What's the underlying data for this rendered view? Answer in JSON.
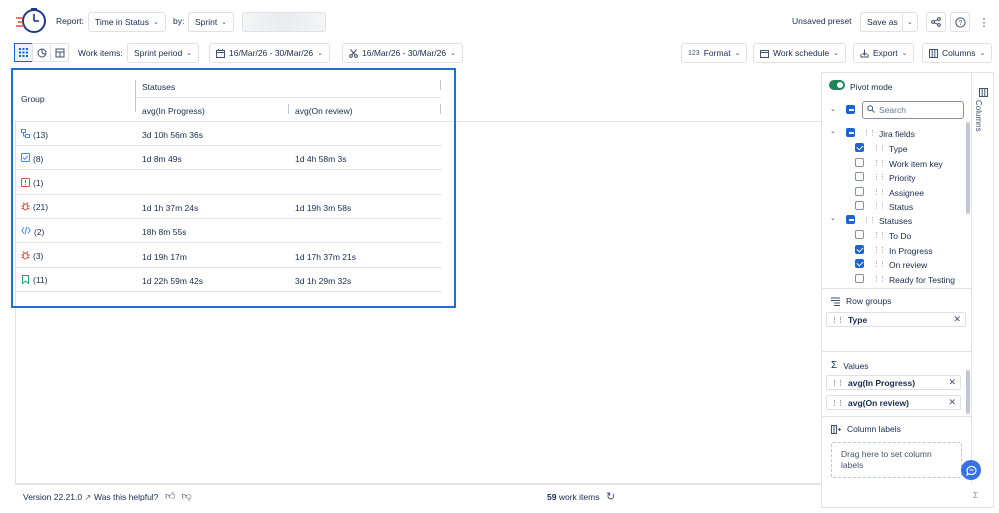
{
  "header": {
    "report_label": "Report:",
    "report_value": "Time in Status",
    "by_label": "by:",
    "by_value": "Sprint",
    "unsaved": "Unsaved preset",
    "save_as": "Save as"
  },
  "toolbar": {
    "work_items_label": "Work items:",
    "sprint_period": "Sprint period",
    "date_range_1": "16/Mar/26 - 30/Mar/26",
    "date_range_2": "16/Mar/26 - 30/Mar/26",
    "format": "Format",
    "work_schedule": "Work schedule",
    "export": "Export",
    "columns": "Columns"
  },
  "grid": {
    "group_header": "Group",
    "statuses_header": "Statuses",
    "col1_header": "avg(In Progress)",
    "col2_header": "avg(On review)",
    "rows": [
      {
        "icon": "subtask-icon",
        "count": "(13)",
        "c1": "3d 10h 56m 36s",
        "c2": ""
      },
      {
        "icon": "task-icon",
        "count": "(8)",
        "c1": "1d 8m 49s",
        "c2": "1d 4h 58m 3s"
      },
      {
        "icon": "epic-icon",
        "count": "(1)",
        "c1": "",
        "c2": ""
      },
      {
        "icon": "bug-icon",
        "count": "(21)",
        "c1": "1d 1h 37m 24s",
        "c2": "1d 19h 3m 58s"
      },
      {
        "icon": "code-icon",
        "count": "(2)",
        "c1": "18h 8m 55s",
        "c2": ""
      },
      {
        "icon": "bug-icon",
        "count": "(3)",
        "c1": "1d 19h 17m",
        "c2": "1d 17h 37m 21s"
      },
      {
        "icon": "story-icon",
        "count": "(11)",
        "c1": "1d 22h 59m 42s",
        "c2": "3d 1h 29m 32s"
      }
    ]
  },
  "footer": {
    "version": "Version 22.21.0",
    "helpful": "Was this helpful?",
    "work_count_num": "59",
    "work_count_label": "work items"
  },
  "panel": {
    "pivot_mode": "Pivot mode",
    "search_placeholder": "Search",
    "jira_fields": "Jira fields",
    "jira_items": [
      "Type",
      "Work item key",
      "Priority",
      "Assignee",
      "Status"
    ],
    "jira_checked": [
      true,
      false,
      false,
      false,
      false
    ],
    "statuses": "Statuses",
    "status_items": [
      "To Do",
      "In Progress",
      "On review",
      "Ready for Testing"
    ],
    "status_checked": [
      false,
      true,
      true,
      false
    ],
    "row_groups": "Row groups",
    "row_group_pill": "Type",
    "values": "Values",
    "value_pills": [
      "avg(In Progress)",
      "avg(On review)"
    ],
    "column_labels": "Column labels",
    "drop_hint": "Drag here to set column labels",
    "side_tab": "Columns"
  },
  "colors": {
    "accent": "#1d63d6",
    "highlight": "#1f6fd1",
    "toggle_on": "#1f845a",
    "subtask": "#4688ec",
    "task": "#4688ec",
    "epic": "#e2483d",
    "bug": "#e2483d",
    "code": "#4688ec",
    "story": "#22a06b"
  }
}
